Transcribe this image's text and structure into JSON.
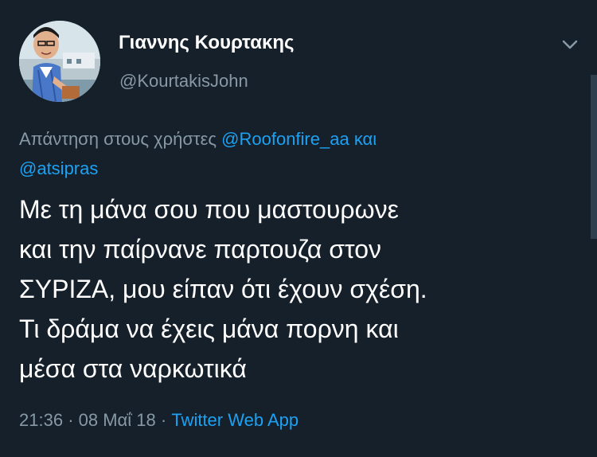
{
  "author": {
    "display_name": "Γιαννης Κουρτακης",
    "handle": "@KourtakisJohn"
  },
  "reply": {
    "prefix": "Απάντηση στους χρήστες",
    "mention_1": "@Roofonfire_aa",
    "conjunction": "και",
    "mention_2": "@atsipras"
  },
  "tweet": {
    "lines": [
      "Με τη μάνα σου που μαστουρωνε",
      "και την παίρνανε παρτουζα στον",
      "ΣΥΡΙΖΑ, μου είπαν ότι έχουν σχέση.",
      "Τι δράμα να έχεις μάνα πορνη και",
      "μέσα στα ναρκωτικά"
    ]
  },
  "meta": {
    "time": "21:36",
    "separator": "·",
    "date": "08 Μαΐ 18",
    "source": "Twitter Web App"
  },
  "icons": {
    "menu": "chevron-down-icon",
    "avatar": "profile-photo"
  },
  "colors": {
    "background": "#15202b",
    "primary_text": "#ffffff",
    "secondary_text": "#8899a6",
    "link": "#1da1f2"
  }
}
